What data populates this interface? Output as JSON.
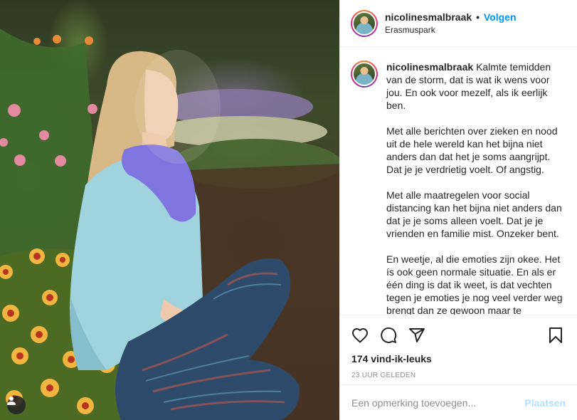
{
  "post": {
    "username": "nicolinesmalbraak",
    "separator": "•",
    "follow_label": "Volgen",
    "location": "Erasmuspark",
    "caption_paragraphs": [
      "Kalmte temidden van de storm, dat is wat ik wens voor jou. En ook voor mezelf, als ik eerlijk ben.",
      "Met alle berichten over zieken en nood uit de hele wereld kan het bijna niet anders dan dat het je soms aangrijpt. Dat je je verdrietig voelt. Of angstig.",
      "Met alle maatregelen voor social distancing kan het bijna niet anders dan dat je je soms alleen voelt. Dat je je vrienden en familie mist. Onzeker bent.",
      "En weetje, al die emoties zijn okee. Het ís ook geen normale situatie. En als er één ding is dat ik weet, is dat vechten tegen je emoties je nog veel verder weg brengt dan ze gewoon maar te"
    ],
    "likes": "174 vind-ik-leuks",
    "timestamp": "23 UUR GELEDEN"
  },
  "comment": {
    "placeholder": "Een opmerking toevoegen...",
    "post_label": "Plaatsen"
  },
  "colors": {
    "accent": "#0095f6",
    "post_disabled": "#b2dffc",
    "text": "#262626",
    "muted": "#8e8e8e"
  },
  "icons": [
    "heart-icon",
    "comment-icon",
    "share-icon",
    "bookmark-icon",
    "user-tag-icon"
  ]
}
